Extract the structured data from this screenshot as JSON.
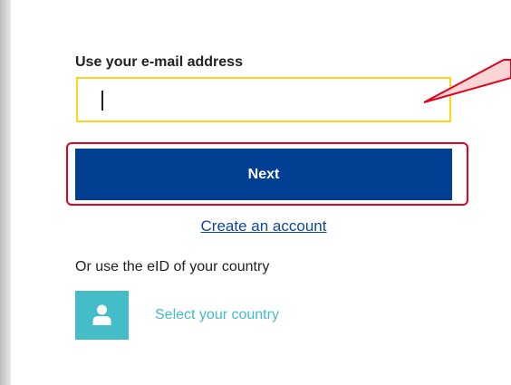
{
  "login": {
    "email_label": "Use your e-mail address",
    "email_value": "",
    "next_label": "Next",
    "create_account_label": "Create an account",
    "eid_text": "Or use the eID of your country",
    "select_country_label": "Select your country"
  },
  "colors": {
    "input_border": "#ffd617",
    "button_bg": "#003f92",
    "highlight": "#e3001b",
    "link": "#0e47a1",
    "teal": "#44bdc9",
    "callout_fill": "#fbd5d5"
  },
  "icons": {
    "country": "user-icon"
  }
}
